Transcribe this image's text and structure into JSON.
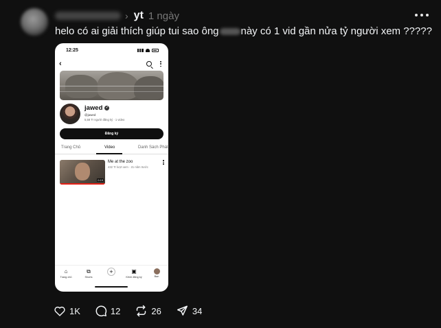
{
  "post": {
    "community": "yt",
    "time": "1 ngày",
    "caption_before": "helo có ai giải thích giúp tui sao ông",
    "caption_after": "này có 1 vid gần nửa tỷ người xem ?????"
  },
  "phone": {
    "status_time": "12:25",
    "channel_name": "jawed",
    "channel_handle": "@jawed",
    "channel_stats": "5,58 Tr người đăng ký · 1 video",
    "subscribe_label": "Đăng ký",
    "tabs": [
      "Trang Chủ",
      "Video",
      "Danh Sách Phát"
    ],
    "active_tab": "Video",
    "video": {
      "title": "Me at the zoo",
      "meta": "432 Tr lượt xem · 21 năm trước",
      "duration": "0:19",
      "watch_progress": 1.0
    },
    "nav": [
      "Trang chủ",
      "Shorts",
      "",
      "Kênh đăng ký",
      "Bạn"
    ]
  },
  "actions": {
    "likes": "1K",
    "comments": "12",
    "reposts": "26",
    "shares": "34"
  },
  "icons": {
    "like": "heart-icon",
    "comment": "comment-icon",
    "repost": "repost-icon",
    "share": "send-icon",
    "more": "more-dots-icon"
  }
}
